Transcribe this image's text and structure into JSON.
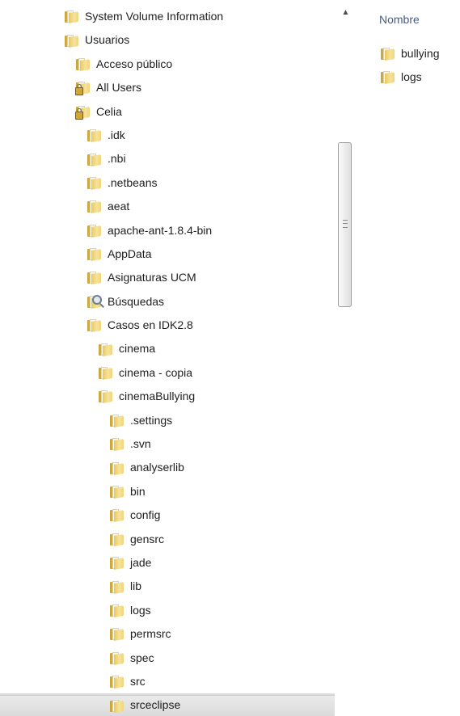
{
  "tree": {
    "items": [
      {
        "label": "System Volume Information",
        "indent": 0,
        "icon": "folder-icon"
      },
      {
        "label": "Usuarios",
        "indent": 0,
        "icon": "folder-icon"
      },
      {
        "label": "Acceso público",
        "indent": 1,
        "icon": "folder-icon"
      },
      {
        "label": "All Users",
        "indent": 1,
        "icon": "folder-lock-icon"
      },
      {
        "label": "Celia",
        "indent": 1,
        "icon": "folder-lock-icon"
      },
      {
        "label": ".idk",
        "indent": 2,
        "icon": "folder-icon"
      },
      {
        "label": ".nbi",
        "indent": 2,
        "icon": "folder-icon"
      },
      {
        "label": ".netbeans",
        "indent": 2,
        "icon": "folder-icon"
      },
      {
        "label": "aeat",
        "indent": 2,
        "icon": "folder-icon"
      },
      {
        "label": "apache-ant-1.8.4-bin",
        "indent": 2,
        "icon": "folder-icon"
      },
      {
        "label": "AppData",
        "indent": 2,
        "icon": "folder-icon"
      },
      {
        "label": "Asignaturas UCM",
        "indent": 2,
        "icon": "folder-icon"
      },
      {
        "label": "Búsquedas",
        "indent": 2,
        "icon": "search-folder-icon"
      },
      {
        "label": "Casos en IDK2.8",
        "indent": 2,
        "icon": "folder-icon"
      },
      {
        "label": "cinema",
        "indent": 3,
        "icon": "folder-icon"
      },
      {
        "label": "cinema - copia",
        "indent": 3,
        "icon": "folder-icon"
      },
      {
        "label": "cinemaBullying",
        "indent": 3,
        "icon": "folder-icon"
      },
      {
        "label": ".settings",
        "indent": 4,
        "icon": "folder-icon"
      },
      {
        "label": ".svn",
        "indent": 4,
        "icon": "folder-icon"
      },
      {
        "label": "analyserlib",
        "indent": 4,
        "icon": "folder-icon"
      },
      {
        "label": "bin",
        "indent": 4,
        "icon": "folder-icon"
      },
      {
        "label": "config",
        "indent": 4,
        "icon": "folder-icon"
      },
      {
        "label": "gensrc",
        "indent": 4,
        "icon": "folder-icon"
      },
      {
        "label": "jade",
        "indent": 4,
        "icon": "folder-icon"
      },
      {
        "label": "lib",
        "indent": 4,
        "icon": "folder-icon"
      },
      {
        "label": "logs",
        "indent": 4,
        "icon": "folder-icon"
      },
      {
        "label": "permsrc",
        "indent": 4,
        "icon": "folder-icon"
      },
      {
        "label": "spec",
        "indent": 4,
        "icon": "folder-icon"
      },
      {
        "label": "src",
        "indent": 4,
        "icon": "folder-icon"
      },
      {
        "label": "srceclipse",
        "indent": 4,
        "icon": "folder-icon",
        "selected": true
      }
    ],
    "scroll_up_icon": "chevron-up-icon",
    "scroll_grip_icon": "grip-icon"
  },
  "content": {
    "column_header": "Nombre",
    "files": [
      {
        "label": "bullying",
        "icon": "folder-icon"
      },
      {
        "label": "logs",
        "icon": "folder-icon"
      }
    ]
  },
  "colors": {
    "folder": "#e9c85f",
    "selection": "#dcdcdc",
    "header_text": "#4a5b7d"
  }
}
